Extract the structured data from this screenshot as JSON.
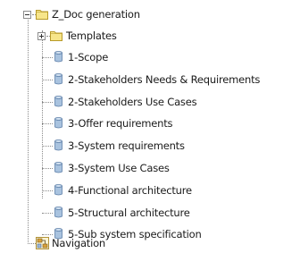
{
  "tree": {
    "root": {
      "label": "Z_Doc generation",
      "icon": "folder-icon",
      "expanded": true
    },
    "templates": {
      "label": "Templates",
      "icon": "folder-icon",
      "expanded": false
    },
    "documents": [
      {
        "label": "1-Scope",
        "icon": "document-cylinder-icon"
      },
      {
        "label": "2-Stakeholders Needs & Requirements",
        "icon": "document-cylinder-icon"
      },
      {
        "label": "2-Stakeholders Use Cases",
        "icon": "document-cylinder-icon"
      },
      {
        "label": "3-Offer requirements",
        "icon": "document-cylinder-icon"
      },
      {
        "label": "3-System requirements",
        "icon": "document-cylinder-icon"
      },
      {
        "label": "3-System Use Cases",
        "icon": "document-cylinder-icon"
      },
      {
        "label": "4-Functional architecture",
        "icon": "document-cylinder-icon"
      },
      {
        "label": "5-Structural architecture",
        "icon": "document-cylinder-icon"
      },
      {
        "label": "5-Sub system specification",
        "icon": "document-cylinder-icon"
      }
    ],
    "navigation": {
      "label": "Navigation",
      "icon": "navigation-diagram-icon"
    },
    "colors": {
      "folder_fill": "#f7e58a",
      "folder_stroke": "#b89a2a",
      "document_fill": "#a9c3df",
      "document_stroke": "#5d7fa8",
      "connector": "#8a8a8a"
    }
  }
}
